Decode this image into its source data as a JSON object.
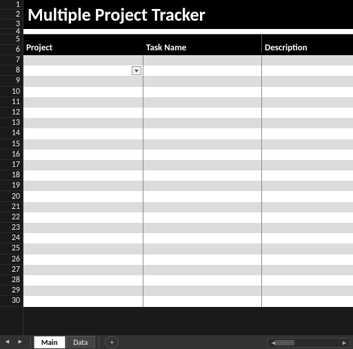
{
  "title": "Multiple Project Tracker",
  "columns": {
    "project": "Project",
    "task": "Task Name",
    "desc": "Description"
  },
  "row_numbers": [
    1,
    2,
    3,
    4,
    5,
    6,
    7,
    8,
    9,
    10,
    11,
    12,
    13,
    14,
    15,
    16,
    17,
    18,
    19,
    20,
    21,
    22,
    23,
    24,
    25,
    26,
    27,
    28,
    29,
    30
  ],
  "row_heights": {
    "1": 14,
    "2": 14,
    "3": 14,
    "4": 8,
    "5": 15,
    "6": 15,
    "default": 15.2
  },
  "layout": {
    "title_rows": [
      1,
      2,
      3
    ],
    "gap_row": 4,
    "header_rows": [
      5,
      6
    ],
    "data_start_row": 7,
    "data_end_row": 30,
    "dropdown_row": 8,
    "dashed_rows": [
      16,
      27
    ]
  },
  "tabs": [
    {
      "label": "Main",
      "active": true
    },
    {
      "label": "Data",
      "active": false
    }
  ],
  "icons": {
    "add_sheet": "+",
    "nav_left": "◄",
    "nav_right": "►"
  }
}
